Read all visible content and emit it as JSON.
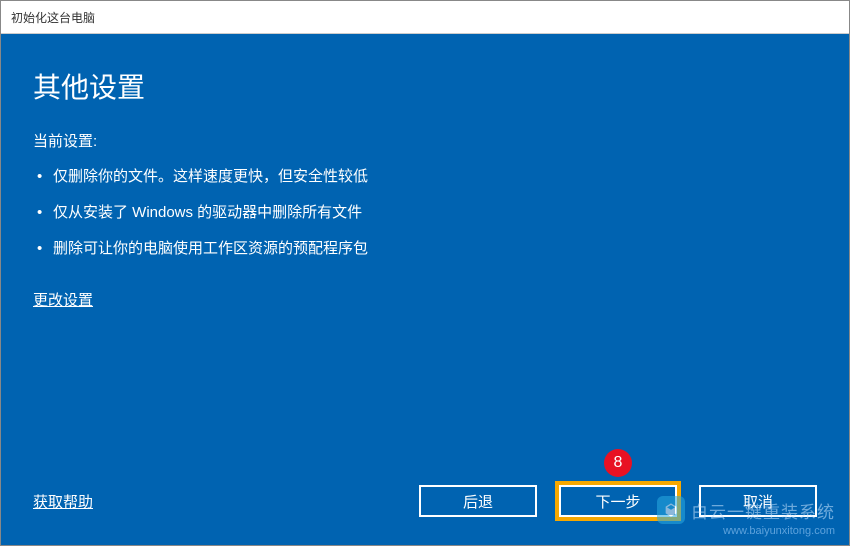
{
  "titlebar": {
    "title": "初始化这台电脑"
  },
  "main": {
    "heading": "其他设置",
    "current_settings_label": "当前设置:",
    "settings": [
      "仅删除你的文件。这样速度更快，但安全性较低",
      "仅从安装了 Windows 的驱动器中删除所有文件",
      "删除可让你的电脑使用工作区资源的预配程序包"
    ],
    "change_settings_label": "更改设置"
  },
  "footer": {
    "help_label": "获取帮助",
    "back_label": "后退",
    "next_label": "下一步",
    "cancel_label": "取消"
  },
  "annotation": {
    "step_number": "8"
  },
  "watermark": {
    "brand": "白云一键重装系统",
    "url": "www.baiyunxitong.com"
  }
}
